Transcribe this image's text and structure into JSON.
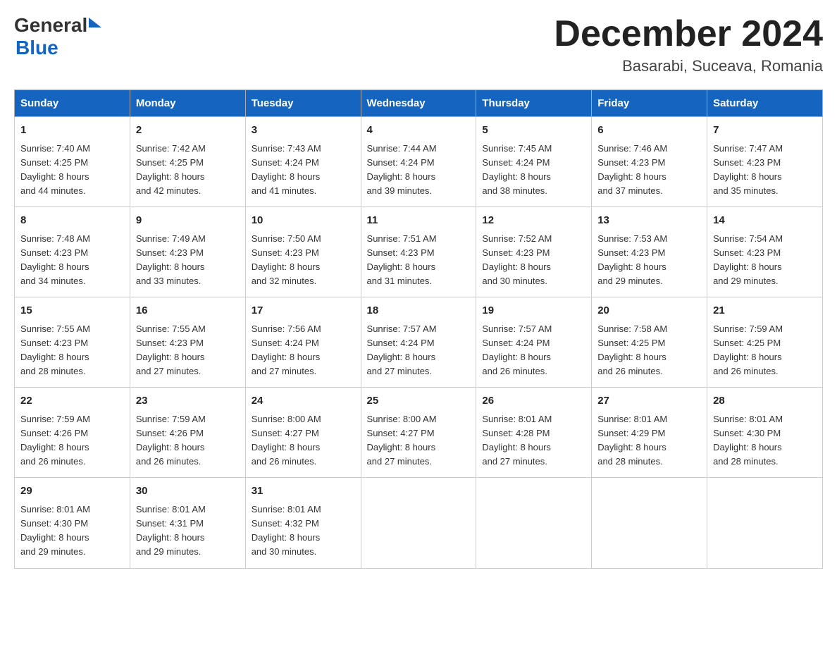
{
  "header": {
    "logo_general": "General",
    "logo_blue": "Blue",
    "title": "December 2024",
    "subtitle": "Basarabi, Suceava, Romania"
  },
  "days_of_week": [
    "Sunday",
    "Monday",
    "Tuesday",
    "Wednesday",
    "Thursday",
    "Friday",
    "Saturday"
  ],
  "weeks": [
    [
      {
        "day": "1",
        "sunrise": "7:40 AM",
        "sunset": "4:25 PM",
        "daylight": "8 hours and 44 minutes."
      },
      {
        "day": "2",
        "sunrise": "7:42 AM",
        "sunset": "4:25 PM",
        "daylight": "8 hours and 42 minutes."
      },
      {
        "day": "3",
        "sunrise": "7:43 AM",
        "sunset": "4:24 PM",
        "daylight": "8 hours and 41 minutes."
      },
      {
        "day": "4",
        "sunrise": "7:44 AM",
        "sunset": "4:24 PM",
        "daylight": "8 hours and 39 minutes."
      },
      {
        "day": "5",
        "sunrise": "7:45 AM",
        "sunset": "4:24 PM",
        "daylight": "8 hours and 38 minutes."
      },
      {
        "day": "6",
        "sunrise": "7:46 AM",
        "sunset": "4:23 PM",
        "daylight": "8 hours and 37 minutes."
      },
      {
        "day": "7",
        "sunrise": "7:47 AM",
        "sunset": "4:23 PM",
        "daylight": "8 hours and 35 minutes."
      }
    ],
    [
      {
        "day": "8",
        "sunrise": "7:48 AM",
        "sunset": "4:23 PM",
        "daylight": "8 hours and 34 minutes."
      },
      {
        "day": "9",
        "sunrise": "7:49 AM",
        "sunset": "4:23 PM",
        "daylight": "8 hours and 33 minutes."
      },
      {
        "day": "10",
        "sunrise": "7:50 AM",
        "sunset": "4:23 PM",
        "daylight": "8 hours and 32 minutes."
      },
      {
        "day": "11",
        "sunrise": "7:51 AM",
        "sunset": "4:23 PM",
        "daylight": "8 hours and 31 minutes."
      },
      {
        "day": "12",
        "sunrise": "7:52 AM",
        "sunset": "4:23 PM",
        "daylight": "8 hours and 30 minutes."
      },
      {
        "day": "13",
        "sunrise": "7:53 AM",
        "sunset": "4:23 PM",
        "daylight": "8 hours and 29 minutes."
      },
      {
        "day": "14",
        "sunrise": "7:54 AM",
        "sunset": "4:23 PM",
        "daylight": "8 hours and 29 minutes."
      }
    ],
    [
      {
        "day": "15",
        "sunrise": "7:55 AM",
        "sunset": "4:23 PM",
        "daylight": "8 hours and 28 minutes."
      },
      {
        "day": "16",
        "sunrise": "7:55 AM",
        "sunset": "4:23 PM",
        "daylight": "8 hours and 27 minutes."
      },
      {
        "day": "17",
        "sunrise": "7:56 AM",
        "sunset": "4:24 PM",
        "daylight": "8 hours and 27 minutes."
      },
      {
        "day": "18",
        "sunrise": "7:57 AM",
        "sunset": "4:24 PM",
        "daylight": "8 hours and 27 minutes."
      },
      {
        "day": "19",
        "sunrise": "7:57 AM",
        "sunset": "4:24 PM",
        "daylight": "8 hours and 26 minutes."
      },
      {
        "day": "20",
        "sunrise": "7:58 AM",
        "sunset": "4:25 PM",
        "daylight": "8 hours and 26 minutes."
      },
      {
        "day": "21",
        "sunrise": "7:59 AM",
        "sunset": "4:25 PM",
        "daylight": "8 hours and 26 minutes."
      }
    ],
    [
      {
        "day": "22",
        "sunrise": "7:59 AM",
        "sunset": "4:26 PM",
        "daylight": "8 hours and 26 minutes."
      },
      {
        "day": "23",
        "sunrise": "7:59 AM",
        "sunset": "4:26 PM",
        "daylight": "8 hours and 26 minutes."
      },
      {
        "day": "24",
        "sunrise": "8:00 AM",
        "sunset": "4:27 PM",
        "daylight": "8 hours and 26 minutes."
      },
      {
        "day": "25",
        "sunrise": "8:00 AM",
        "sunset": "4:27 PM",
        "daylight": "8 hours and 27 minutes."
      },
      {
        "day": "26",
        "sunrise": "8:01 AM",
        "sunset": "4:28 PM",
        "daylight": "8 hours and 27 minutes."
      },
      {
        "day": "27",
        "sunrise": "8:01 AM",
        "sunset": "4:29 PM",
        "daylight": "8 hours and 28 minutes."
      },
      {
        "day": "28",
        "sunrise": "8:01 AM",
        "sunset": "4:30 PM",
        "daylight": "8 hours and 28 minutes."
      }
    ],
    [
      {
        "day": "29",
        "sunrise": "8:01 AM",
        "sunset": "4:30 PM",
        "daylight": "8 hours and 29 minutes."
      },
      {
        "day": "30",
        "sunrise": "8:01 AM",
        "sunset": "4:31 PM",
        "daylight": "8 hours and 29 minutes."
      },
      {
        "day": "31",
        "sunrise": "8:01 AM",
        "sunset": "4:32 PM",
        "daylight": "8 hours and 30 minutes."
      },
      null,
      null,
      null,
      null
    ]
  ],
  "labels": {
    "sunrise": "Sunrise:",
    "sunset": "Sunset:",
    "daylight": "Daylight:"
  }
}
